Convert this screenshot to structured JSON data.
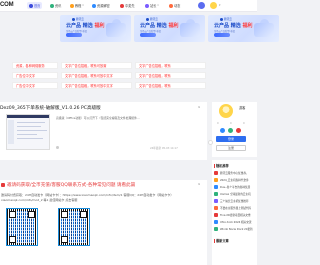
{
  "nav": {
    "logo": "COM",
    "items": [
      {
        "label": "首页",
        "color": "#3b4bdc",
        "active": true
      },
      {
        "label": "资讯",
        "color": "#2fb27c",
        "active": false
      },
      {
        "label": "教程",
        "color": "#ff9f1c",
        "active": false
      },
      {
        "label": "资源解密",
        "color": "#2e8bff",
        "active": false
      },
      {
        "label": "中奖先",
        "color": "#e53a3a",
        "active": false
      },
      {
        "label": "站长",
        "color": "#7b5cff",
        "active": false
      },
      {
        "label": "动态",
        "color": "#ff6a3d",
        "active": false
      }
    ]
  },
  "ads": [
    {
      "brand": "腾讯云",
      "title_prefix": "云产品 ",
      "title": "精选 ",
      "title_hot": "福利",
      "sub": "全场云产品低至1折起"
    },
    {
      "brand": "腾讯云",
      "title_prefix": "云产品 ",
      "title": "精选 ",
      "title_hot": "福利",
      "sub": "全场云产品低至1折起"
    },
    {
      "brand": "腾讯云",
      "title_prefix": "云产品 ",
      "title": "精选 ",
      "title_hot": "福利",
      "sub": "全场云产品低至1折起"
    }
  ],
  "promo_rows": [
    [
      "资源，各种网络服务",
      "文字广告位招租，联系可放置",
      "文字广告位招租，联系"
    ],
    [
      "广告位中文字",
      "文字广告位招租，联系可放中文字",
      "文字广告位招租，联系"
    ],
    [
      "广告位中文字",
      "文字广告位招租，联系可放中文字",
      "文字广告位招租，联系"
    ]
  ],
  "article1": {
    "title": "Dez09_365下单系统-破解版_V1.0.26 PC高级版",
    "expand": "∨",
    "excerpt": "高级版（Office功能）可以打开下（包括完全编辑及文件处理组件…",
    "meta_right": "24年最新 05-03 14:17"
  },
  "article2": {
    "title": "邀请码获取/全币充值/客服QQ联系方式-各种常见问题 请看此篇",
    "expand": "∨",
    "line1": "邀请码付费获取：24H自动发卡（网站卡卡）：https://www.xiaomaoqk.com/info/item/1 客服QQ：24H自动发卡（网站卡卡）",
    "line2": "xiaomaoqk.com/info/mod_2 等1 最佳网站卡 点击客服"
  },
  "sidebar": {
    "name": "游客",
    "stats": [
      "0",
      "0",
      "0"
    ],
    "login": "登录",
    "register": "注册",
    "hot_title": "随机推荐",
    "list": [
      {
        "text": "腾讯云服务中心优惠券，",
        "color": "#e53a3a"
      },
      {
        "text": "2024_云主机各种代金劵",
        "color": "#ff9f1c"
      },
      {
        "text": "Dus--各个平台的各种优质",
        "color": "#2e8bff"
      },
      {
        "text": "Uomax 全球最新的云主机",
        "color": "#2fb27c"
      },
      {
        "text": "三个站长云主机优惠推荐",
        "color": "#7b5cff"
      },
      {
        "text": "不要在主服务器上测试代码",
        "color": "#ff6a3d"
      },
      {
        "text": "Tina XR更新项目相关文章",
        "color": "#e53a3a"
      },
      {
        "text": "Ufox dock 2024 相关交流",
        "color": "#2e8bff"
      },
      {
        "text": "Windo Nocw Dock 24更新",
        "color": "#2fb27c"
      }
    ],
    "section2": "最新文章"
  }
}
